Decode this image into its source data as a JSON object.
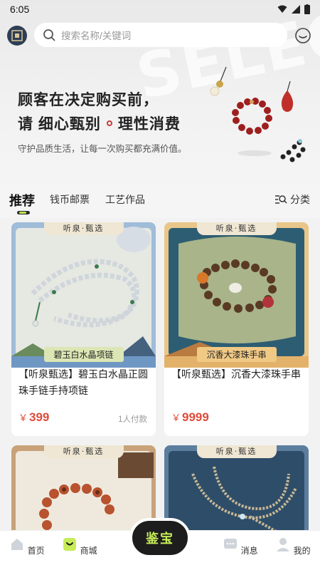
{
  "status": {
    "time": "6:05"
  },
  "search": {
    "placeholder": "搜索名称/关键词"
  },
  "hero": {
    "watermark": "SELECT",
    "headline_line1": "顾客在决定购买前，",
    "headline_line2_a": "请 细心甄别",
    "headline_line2_b": "理性消费",
    "subline": "守护品质生活，让每一次购买都充满价值。"
  },
  "tabs": [
    {
      "label": "推荐",
      "active": true
    },
    {
      "label": "钱币邮票",
      "active": false
    },
    {
      "label": "工艺作品",
      "active": false
    }
  ],
  "category_label": "分类",
  "products": [
    {
      "banner": "听泉·甄选",
      "caption": "碧玉白水晶项链",
      "title": "【听泉甄选】碧玉白水晶正圆珠手链手持项链",
      "currency": "￥",
      "price": "399",
      "paid": "1人付款"
    },
    {
      "banner": "听泉·甄选",
      "caption": "沉香大漆珠手串",
      "title": "【听泉甄选】沉香大漆珠手串",
      "currency": "￥",
      "price": "9999",
      "paid": ""
    },
    {
      "banner": "听泉·甄选"
    },
    {
      "banner": "听泉·甄选"
    }
  ],
  "nav": {
    "home": "首页",
    "mall": "商城",
    "appraise": "鉴宝",
    "messages": "消息",
    "mine": "我的"
  },
  "colors": {
    "accent": "#c6ec57",
    "price": "#e04a3a",
    "dark": "#1d1d1d"
  }
}
